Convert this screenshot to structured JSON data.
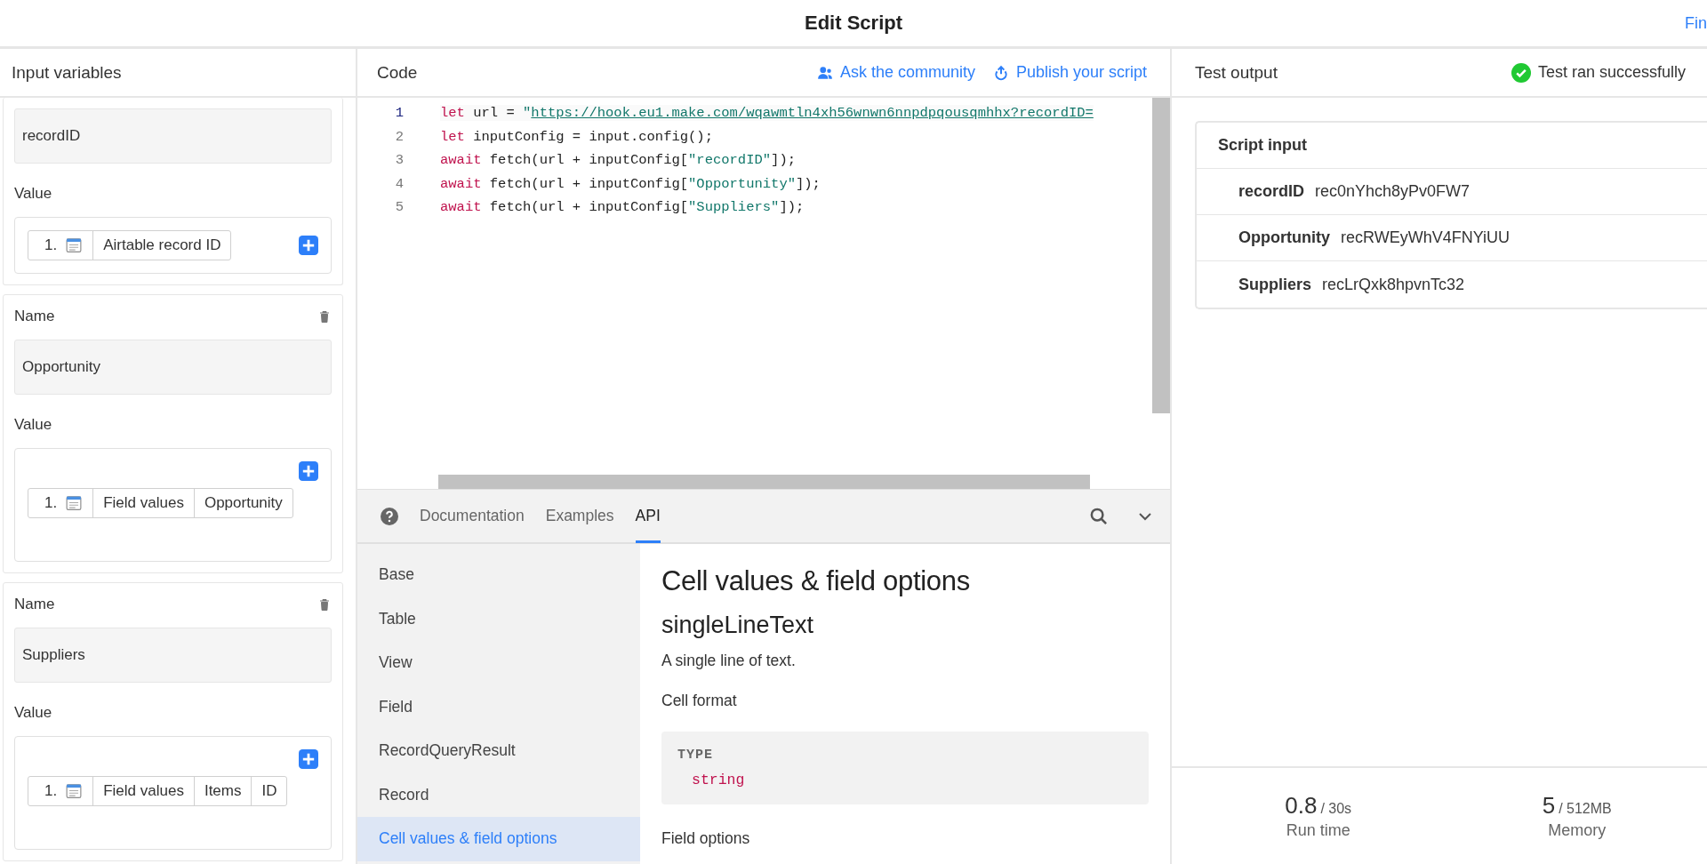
{
  "window": {
    "title": "Edit Script",
    "finish_link": "Fin"
  },
  "input_panel": {
    "title": "Input variables",
    "cards": [
      {
        "kind": "inline",
        "name": "recordID",
        "value_label": "Value",
        "row": {
          "index": "1.",
          "segments": [
            "Airtable record ID"
          ]
        }
      },
      {
        "kind": "stacked",
        "name_label": "Name",
        "name": "Opportunity",
        "value_label": "Value",
        "row": {
          "index": "1.",
          "segments": [
            "Field values",
            "Opportunity"
          ]
        }
      },
      {
        "kind": "stacked",
        "name_label": "Name",
        "name": "Suppliers",
        "value_label": "Value",
        "row": {
          "index": "1.",
          "segments": [
            "Field values",
            "Items",
            "ID"
          ]
        }
      }
    ]
  },
  "code_panel": {
    "title": "Code",
    "actions": [
      {
        "kind": "community",
        "label": "Ask the community"
      },
      {
        "kind": "publish",
        "label": "Publish your script"
      }
    ],
    "lines": [
      {
        "number": "1",
        "active": true,
        "tokens": [
          {
            "kind": "keyword",
            "text": "let"
          },
          {
            "kind": "plain",
            "text": " url = "
          },
          {
            "kind": "string",
            "text": "\""
          },
          {
            "kind": "link",
            "text": "https://hook.eu1.make.com/wqawmtln4xh56wnwn6nnpdpqousqmhhx?recordID="
          }
        ]
      },
      {
        "number": "2",
        "active": false,
        "tokens": [
          {
            "kind": "keyword",
            "text": "let"
          },
          {
            "kind": "plain",
            "text": " inputConfig = input.config();"
          }
        ]
      },
      {
        "number": "3",
        "active": false,
        "tokens": [
          {
            "kind": "keyword",
            "text": "await"
          },
          {
            "kind": "plain",
            "text": " fetch(url + inputConfig["
          },
          {
            "kind": "string",
            "text": "\"recordID\""
          },
          {
            "kind": "plain",
            "text": "]);"
          }
        ]
      },
      {
        "number": "4",
        "active": false,
        "tokens": [
          {
            "kind": "keyword",
            "text": "await"
          },
          {
            "kind": "plain",
            "text": " fetch(url + inputConfig["
          },
          {
            "kind": "string",
            "text": "\"Opportunity\""
          },
          {
            "kind": "plain",
            "text": "]);"
          }
        ]
      },
      {
        "number": "5",
        "active": false,
        "tokens": [
          {
            "kind": "keyword",
            "text": "await"
          },
          {
            "kind": "plain",
            "text": " fetch(url + inputConfig["
          },
          {
            "kind": "string",
            "text": "\"Suppliers\""
          },
          {
            "kind": "plain",
            "text": "]);"
          }
        ]
      }
    ]
  },
  "docs": {
    "tabs": [
      {
        "label": "Documentation",
        "selected": false
      },
      {
        "label": "Examples",
        "selected": false
      },
      {
        "label": "API",
        "selected": true
      }
    ],
    "nav": [
      {
        "label": "Base",
        "selected": false
      },
      {
        "label": "Table",
        "selected": false
      },
      {
        "label": "View",
        "selected": false
      },
      {
        "label": "Field",
        "selected": false
      },
      {
        "label": "RecordQueryResult",
        "selected": false
      },
      {
        "label": "Record",
        "selected": false
      },
      {
        "label": "Cell values & field options",
        "selected": true
      }
    ],
    "heading": "Cell values & field options",
    "subheading": "singleLineText",
    "description": "A single line of text.",
    "format_label": "Cell format",
    "type_label": "TYPE",
    "type_value": "string",
    "options_label": "Field options"
  },
  "test_output": {
    "title": "Test output",
    "status": "Test ran successfully",
    "card_title": "Script input",
    "rows": [
      {
        "key": "recordID",
        "value": "rec0nYhch8yPv0FW7"
      },
      {
        "key": "Opportunity",
        "value": "recRWEyWhV4FNYiUU"
      },
      {
        "key": "Suppliers",
        "value": "recLrQxk8hpvnTc32"
      }
    ],
    "stats": [
      {
        "value": "0.8",
        "limit": "/ 30s",
        "label": "Run time"
      },
      {
        "value": "5",
        "limit": "/ 512MB",
        "label": "Memory"
      }
    ]
  }
}
